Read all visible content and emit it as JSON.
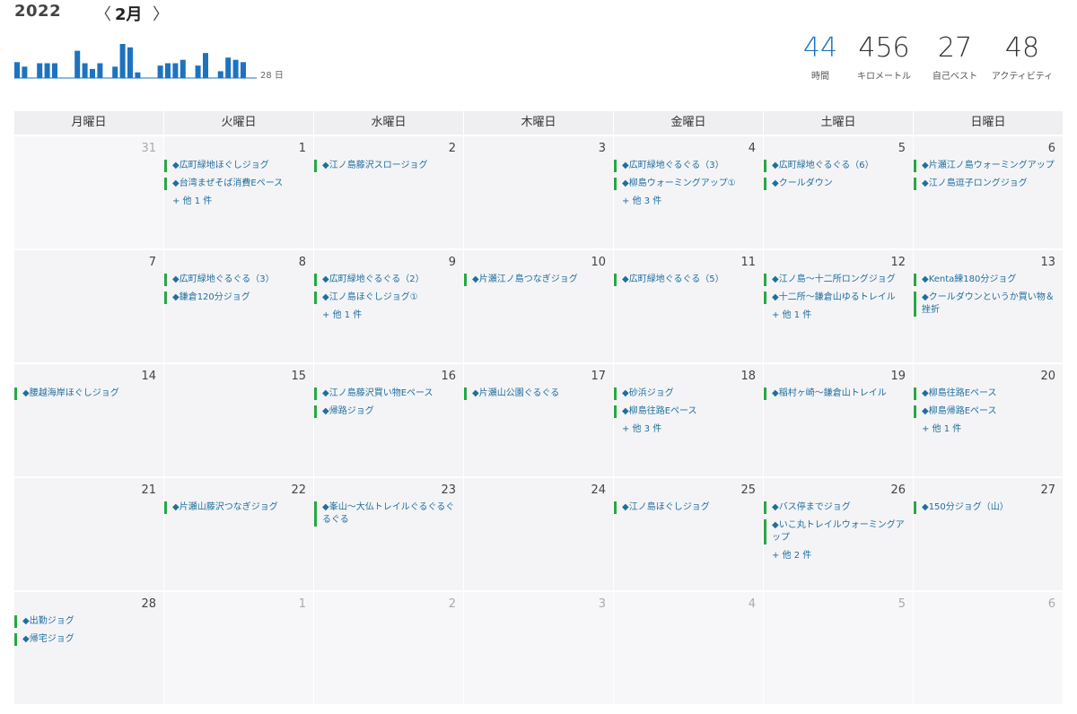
{
  "header": {
    "year": "2022",
    "prev": "〈",
    "month": "2月",
    "next": "〉",
    "days_label": "28 日",
    "mini_chart_values": [
      14,
      10,
      0,
      13,
      13,
      13,
      0,
      0,
      24,
      13,
      8,
      13,
      0,
      10,
      30,
      27,
      5,
      0,
      0,
      11,
      13,
      13,
      16,
      0,
      11,
      22,
      0,
      6,
      18,
      16,
      14,
      0
    ],
    "stats": [
      {
        "value": "44",
        "label": "時間"
      },
      {
        "value": "456",
        "label": "キロメートル"
      },
      {
        "value": "27",
        "label": "自己ベスト"
      },
      {
        "value": "48",
        "label": "アクティビティ"
      }
    ],
    "accent_color": "#1e73be",
    "event_bar_color": "#27a745"
  },
  "weekdays": [
    "月曜日",
    "火曜日",
    "水曜日",
    "木曜日",
    "金曜日",
    "土曜日",
    "日曜日"
  ],
  "days": [
    {
      "num": "31",
      "other": true,
      "events": [],
      "more": ""
    },
    {
      "num": "1",
      "other": false,
      "events": [
        "◆広町緑地ほぐしジョグ",
        "◆台湾まぜそば消費Eペース"
      ],
      "more": "+ 他 1 件"
    },
    {
      "num": "2",
      "other": false,
      "events": [
        "◆江ノ島藤沢スロージョグ"
      ],
      "more": ""
    },
    {
      "num": "3",
      "other": false,
      "events": [],
      "more": ""
    },
    {
      "num": "4",
      "other": false,
      "events": [
        "◆広町緑地ぐるぐる（3）",
        "◆柳島ウォーミングアップ①"
      ],
      "more": "+ 他 3 件"
    },
    {
      "num": "5",
      "other": false,
      "events": [
        "◆広町緑地ぐるぐる（6）",
        "◆クールダウン"
      ],
      "more": ""
    },
    {
      "num": "6",
      "other": false,
      "events": [
        "◆片瀬江ノ島ウォーミングアップ",
        "◆江ノ島逗子ロングジョグ"
      ],
      "more": ""
    },
    {
      "num": "7",
      "other": false,
      "events": [],
      "more": ""
    },
    {
      "num": "8",
      "other": false,
      "events": [
        "◆広町緑地ぐるぐる（3）",
        "◆鎌倉120分ジョグ"
      ],
      "more": ""
    },
    {
      "num": "9",
      "other": false,
      "events": [
        "◆広町緑地ぐるぐる（2）",
        "◆江ノ島ほぐしジョグ①"
      ],
      "more": "+ 他 1 件"
    },
    {
      "num": "10",
      "other": false,
      "events": [
        "◆片瀬江ノ島つなぎジョグ"
      ],
      "more": ""
    },
    {
      "num": "11",
      "other": false,
      "events": [
        "◆広町緑地ぐるぐる（5）"
      ],
      "more": ""
    },
    {
      "num": "12",
      "other": false,
      "events": [
        "◆江ノ島～十二所ロングジョグ",
        "◆十二所～鎌倉山ゆるトレイル"
      ],
      "more": "+ 他 1 件"
    },
    {
      "num": "13",
      "other": false,
      "events": [
        "◆Kenta練180分ジョグ",
        "◆クールダウンというか買い物＆挫折"
      ],
      "more": ""
    },
    {
      "num": "14",
      "other": false,
      "events": [
        "◆腰越海岸ほぐしジョグ"
      ],
      "more": ""
    },
    {
      "num": "15",
      "other": false,
      "events": [],
      "more": ""
    },
    {
      "num": "16",
      "other": false,
      "events": [
        "◆江ノ島藤沢買い物Eペース",
        "◆帰路ジョグ"
      ],
      "more": ""
    },
    {
      "num": "17",
      "other": false,
      "events": [
        "◆片瀬山公園ぐるぐる"
      ],
      "more": ""
    },
    {
      "num": "18",
      "other": false,
      "events": [
        "◆砂浜ジョグ",
        "◆柳島往路Eペース"
      ],
      "more": "+ 他 3 件"
    },
    {
      "num": "19",
      "other": false,
      "events": [
        "◆稲村ヶ崎～鎌倉山トレイル"
      ],
      "more": ""
    },
    {
      "num": "20",
      "other": false,
      "events": [
        "◆柳島往路Eペース",
        "◆柳島帰路Eペース"
      ],
      "more": "+ 他 1 件"
    },
    {
      "num": "21",
      "other": false,
      "events": [],
      "more": ""
    },
    {
      "num": "22",
      "other": false,
      "events": [
        "◆片瀬山藤沢つなぎジョグ"
      ],
      "more": ""
    },
    {
      "num": "23",
      "other": false,
      "events": [
        "◆峯山～大仏トレイルぐるぐるぐるぐる"
      ],
      "more": ""
    },
    {
      "num": "24",
      "other": false,
      "events": [],
      "more": ""
    },
    {
      "num": "25",
      "other": false,
      "events": [
        "◆江ノ島ほぐしジョグ"
      ],
      "more": ""
    },
    {
      "num": "26",
      "other": false,
      "events": [
        "◆バス停までジョグ",
        "◆いこ丸トレイルウォーミングアップ"
      ],
      "more": "+ 他 2 件"
    },
    {
      "num": "27",
      "other": false,
      "events": [
        "◆150分ジョグ（山）"
      ],
      "more": ""
    },
    {
      "num": "28",
      "other": false,
      "events": [
        "◆出勤ジョグ",
        "◆帰宅ジョグ"
      ],
      "more": ""
    },
    {
      "num": "1",
      "other": true,
      "events": [],
      "more": ""
    },
    {
      "num": "2",
      "other": true,
      "events": [],
      "more": ""
    },
    {
      "num": "3",
      "other": true,
      "events": [],
      "more": ""
    },
    {
      "num": "4",
      "other": true,
      "events": [],
      "more": ""
    },
    {
      "num": "5",
      "other": true,
      "events": [],
      "more": ""
    },
    {
      "num": "6",
      "other": true,
      "events": [],
      "more": ""
    }
  ]
}
